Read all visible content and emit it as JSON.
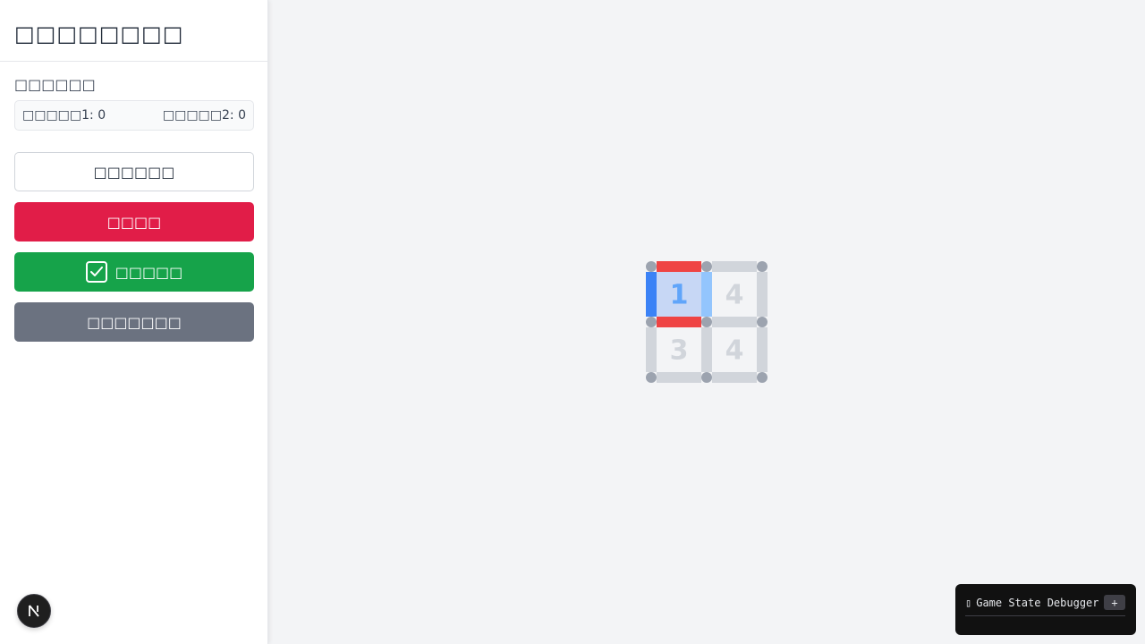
{
  "sidebar": {
    "title": "□□□□□□□□",
    "score_label": "□□□□□□",
    "scores": [
      {
        "label": "□□□□□1: 0"
      },
      {
        "label": "□□□□□2: 0"
      }
    ],
    "buttons": {
      "outline": "□□□□□□",
      "red": "□□□□",
      "green": "□□□□□",
      "gray": "□□□□□□□"
    }
  },
  "board": {
    "rows": 2,
    "cols": 2,
    "cells": [
      {
        "row": 0,
        "col": 0,
        "number": "1",
        "state": "selected"
      },
      {
        "row": 0,
        "col": 1,
        "number": "4",
        "state": "normal"
      },
      {
        "row": 1,
        "col": 0,
        "number": "3",
        "state": "normal"
      },
      {
        "row": 1,
        "col": 1,
        "number": "4",
        "state": "normal"
      }
    ],
    "highlighted_edges": [
      {
        "edge": "top of cell 1,1",
        "color": "#ef4444"
      },
      {
        "edge": "bottom of cell 1,1",
        "color": "#ef4444"
      },
      {
        "edge": "left of cell 1,1",
        "color": "#3b82f6"
      },
      {
        "edge": "right of cell 1,1",
        "color": "#93c5fd"
      }
    ]
  },
  "colors": {
    "red_button": "#e11d48",
    "green_button": "#16a34a",
    "gray_button": "#6b7280",
    "edge_red": "#ef4444",
    "edge_blue": "#3b82f6",
    "edge_light_blue": "#93c5fd",
    "edge_default": "#d1d5db",
    "dot": "#9ca3af",
    "selected_cell": "#c7d7f5",
    "selected_number": "#60a5fa",
    "default_number": "#d1d5db"
  },
  "icons": {
    "check": "check-square-icon",
    "next": "next-logo-icon",
    "debugger": "debugger-icon"
  },
  "debugger": {
    "icon": "▯",
    "title": "Game State Debugger",
    "toggle": "+"
  }
}
